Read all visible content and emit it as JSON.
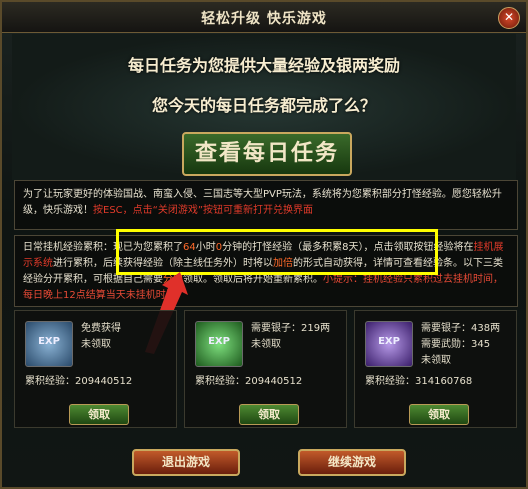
{
  "window": {
    "title": "轻松升级  快乐游戏",
    "close_symbol": "✕"
  },
  "hero": {
    "line1": "每日任务为您提供大量经验及银两奖励",
    "line2": "您今天的每日任务都完成了么？",
    "button_label": "查看每日任务"
  },
  "notice": {
    "text_a": "为了让玩家更好的体验国战、南蛮入侵、三国志等大型PVP玩法，系统将为您累积部分打怪经验。愿您轻松升级，快乐游戏！",
    "text_b": "按ESC，点击“关闭游戏”按钮可重新打开兑换界面"
  },
  "info": {
    "p1": "日常挂机经验累积：现已为您累积了",
    "hours": "64",
    "p2": "小时",
    "minutes": "0",
    "p3": "分钟的打怪经验（最多积累8天），点击领取按钮经验将在",
    "link": "挂机展示系统",
    "p4": "进行累积，后续获得经验（除主线任务外）时将以",
    "multiplier": "加倍",
    "p5": "的形式自动获得，详情可查看经验条。以下三类经验分开累积，可根据自己需要",
    "choose": "分别",
    "p6": "领取。领取后将开始重新累积。",
    "tip": "小提示：挂机经验只累积过去挂机时间，每日晚上12点结算当天未挂机时间。"
  },
  "cards": [
    {
      "icon_text": "EXP",
      "line1": "免费获得",
      "line2": "未领取",
      "line3": "",
      "accum": "累积经验：209440512",
      "button": "领取"
    },
    {
      "icon_text": "EXP",
      "line1": "需要银子：219两",
      "line2": "未领取",
      "line3": "",
      "accum": "累积经验：209440512",
      "button": "领取"
    },
    {
      "icon_text": "EXP",
      "line1": "需要银子：438两",
      "line2": "需要武勋：345",
      "line3": "未领取",
      "accum": "累积经验：314160768",
      "button": "领取"
    }
  ],
  "footer": {
    "exit_label": "退出游戏",
    "continue_label": "继续游戏"
  },
  "colors": {
    "highlight_frame": "#ffff00",
    "arrow": "#e0302a"
  }
}
